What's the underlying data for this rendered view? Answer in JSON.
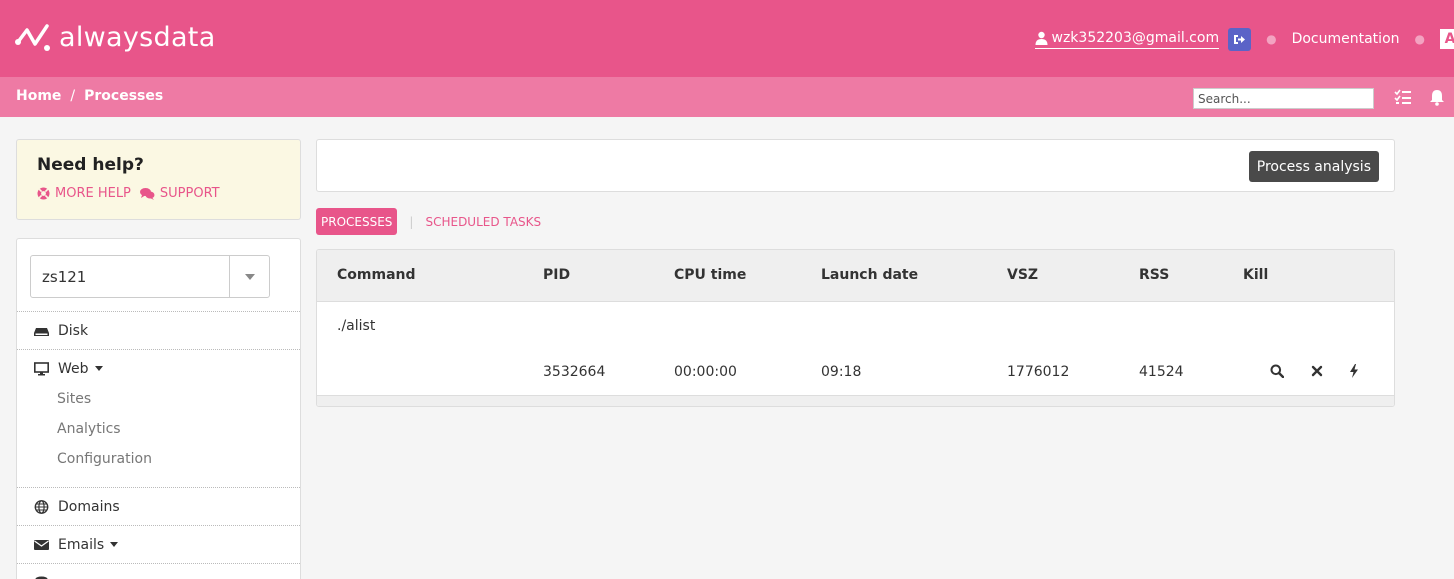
{
  "header": {
    "brand": "alwaysdata",
    "user_email": "wzk352203@gmail.com",
    "documentation": "Documentation",
    "lang": "A",
    "brand_color": "#e8558a"
  },
  "breadcrumb": {
    "home": "Home",
    "separator": "/",
    "current": "Processes",
    "search_placeholder": "Search..."
  },
  "help": {
    "title": "Need help?",
    "more_help": "MORE HELP",
    "support": "SUPPORT"
  },
  "sidebar": {
    "account": "zs121",
    "items": [
      {
        "label": "Disk",
        "icon": "disk-icon"
      },
      {
        "label": "Web",
        "icon": "monitor-icon"
      },
      {
        "label": "Domains",
        "icon": "globe-icon"
      },
      {
        "label": "Emails",
        "icon": "envelope-icon"
      }
    ],
    "web_sub": [
      "Sites",
      "Analytics",
      "Configuration"
    ]
  },
  "main": {
    "analysis_button": "Process analysis",
    "tabs": {
      "active": "PROCESSES",
      "separator": "|",
      "other": "SCHEDULED TASKS"
    },
    "table": {
      "headers": [
        "Command",
        "PID",
        "CPU time",
        "Launch date",
        "VSZ",
        "RSS",
        "Kill"
      ],
      "rows": [
        {
          "command": "./alist",
          "pid": "3532664",
          "cpu_time": "00:00:00",
          "launch_date": "09:18",
          "vsz": "1776012",
          "rss": "41524"
        }
      ]
    }
  }
}
